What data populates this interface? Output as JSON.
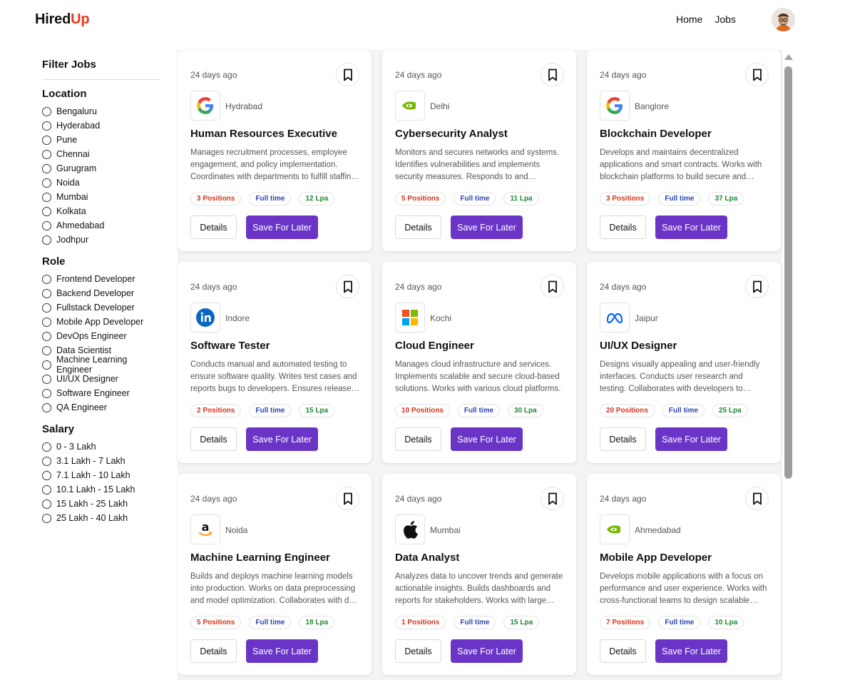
{
  "brand": {
    "part1": "Hired",
    "part2": "Up",
    "accent": "#e8391c"
  },
  "nav": {
    "home": "Home",
    "jobs": "Jobs"
  },
  "filters": {
    "heading": "Filter Jobs",
    "location": {
      "title": "Location",
      "options": [
        "Bengaluru",
        "Hyderabad",
        "Pune",
        "Chennai",
        "Gurugram",
        "Noida",
        "Mumbai",
        "Kolkata",
        "Ahmedabad",
        "Jodhpur"
      ]
    },
    "role": {
      "title": "Role",
      "options": [
        "Frontend Developer",
        "Backend Developer",
        "Fullstack Developer",
        "Mobile App Developer",
        "DevOps Engineer",
        "Data Scientist",
        "Machine Learning Engineer",
        "UI/UX Designer",
        "Software Engineer",
        "QA Engineer"
      ]
    },
    "salary": {
      "title": "Salary",
      "options": [
        "0 - 3 Lakh",
        "3.1 Lakh - 7 Lakh",
        "7.1 Lakh - 10 Lakh",
        "10.1 Lakh - 15 Lakh",
        "15 Lakh - 25 Lakh",
        "25 Lakh - 40 Lakh"
      ]
    }
  },
  "job_card_labels": {
    "details": "Details",
    "save": "Save For Later"
  },
  "jobs": [
    {
      "posted": "24 days ago",
      "company_icon": "google-logo-icon",
      "location": "Hydrabad",
      "title": "Human Resources Executive",
      "description": "Manages recruitment processes, employee engagement, and policy implementation. Coordinates with departments to fulfill staffing needs.",
      "positions": "3 Positions",
      "type": "Full time",
      "salary": "12 Lpa"
    },
    {
      "posted": "24 days ago",
      "company_icon": "nvidia-logo-icon",
      "location": "Delhi",
      "title": "Cybersecurity Analyst",
      "description": "Monitors and secures networks and systems. Identifies vulnerabilities and implements security measures. Responds to and investigates incidents.",
      "positions": "5 Positions",
      "type": "Full time",
      "salary": "11 Lpa"
    },
    {
      "posted": "24 days ago",
      "company_icon": "google-logo-icon",
      "location": "Banglore",
      "title": "Blockchain Developer",
      "description": "Develops and maintains decentralized applications and smart contracts. Works with blockchain platforms to build secure and scalable solutions.",
      "positions": "3 Positions",
      "type": "Full time",
      "salary": "37 Lpa"
    },
    {
      "posted": "24 days ago",
      "company_icon": "linkedin-logo-icon",
      "location": "Indore",
      "title": "Software Tester",
      "description": "Conducts manual and automated testing to ensure software quality. Writes test cases and reports bugs to developers. Ensures release readiness.",
      "positions": "2 Positions",
      "type": "Full time",
      "salary": "15 Lpa"
    },
    {
      "posted": "24 days ago",
      "company_icon": "microsoft-logo-icon",
      "location": "Kochi",
      "title": "Cloud Engineer",
      "description": "Manages cloud infrastructure and services. Implements scalable and secure cloud-based solutions. Works with various cloud platforms.",
      "positions": "10 Positions",
      "type": "Full time",
      "salary": "30 Lpa"
    },
    {
      "posted": "24 days ago",
      "company_icon": "meta-logo-icon",
      "location": "Jaipur",
      "title": "UI/UX Designer",
      "description": "Designs visually appealing and user-friendly interfaces. Conducts user research and testing. Collaborates with developers to implement designs.",
      "positions": "20 Positions",
      "type": "Full time",
      "salary": "25 Lpa"
    },
    {
      "posted": "24 days ago",
      "company_icon": "amazon-logo-icon",
      "location": "Noida",
      "title": "Machine Learning Engineer",
      "description": "Builds and deploys machine learning models into production. Works on data preprocessing and model optimization. Collaborates with data scientists.",
      "positions": "5 Positions",
      "type": "Full time",
      "salary": "18 Lpa"
    },
    {
      "posted": "24 days ago",
      "company_icon": "apple-logo-icon",
      "location": "Mumbai",
      "title": "Data Analyst",
      "description": "Analyzes data to uncover trends and generate actionable insights. Builds dashboards and reports for stakeholders. Works with large datasets.",
      "positions": "1 Positions",
      "type": "Full time",
      "salary": "15 Lpa"
    },
    {
      "posted": "24 days ago",
      "company_icon": "nvidia-logo-icon",
      "location": "Ahmedabad",
      "title": "Mobile App Developer",
      "description": "Develops mobile applications with a focus on performance and user experience. Works with cross-functional teams to design scalable apps.",
      "positions": "7 Positions",
      "type": "Full time",
      "salary": "10 Lpa"
    }
  ],
  "colors": {
    "primary_button": "#6a35c7",
    "positions": "#d9341a",
    "type": "#2b47b8",
    "salary": "#1b8a2e"
  }
}
